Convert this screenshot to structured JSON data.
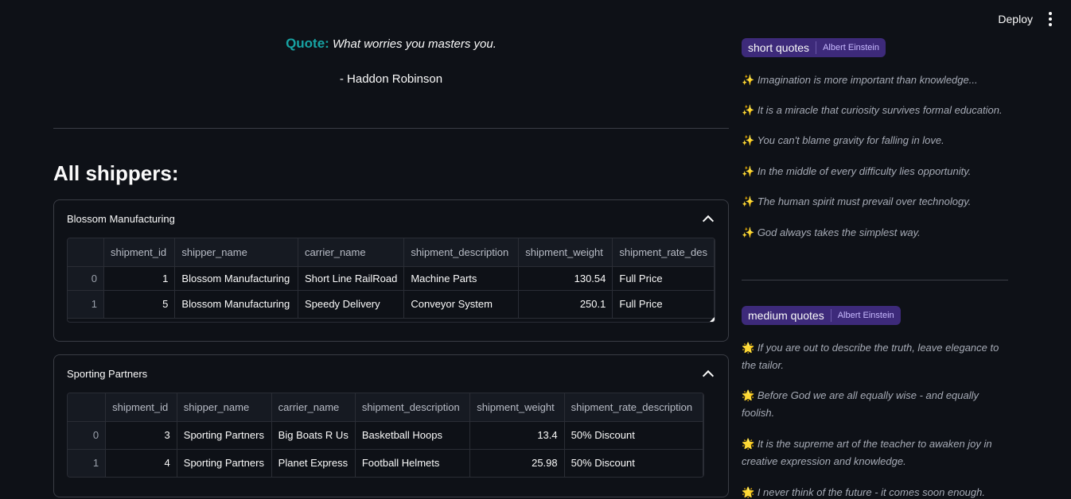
{
  "topbar": {
    "deploy_label": "Deploy"
  },
  "quote": {
    "label": "Quote:",
    "text": "What worries you masters you.",
    "author": "- Haddon Robinson"
  },
  "section_title": "All shippers:",
  "expanders": [
    {
      "title": "Blossom Manufacturing",
      "columns": [
        "",
        "shipment_id",
        "shipper_name",
        "carrier_name",
        "shipment_description",
        "shipment_weight",
        "shipment_rate_des"
      ],
      "rows": [
        [
          "0",
          "1",
          "Blossom Manufacturing",
          "Short Line RailRoad",
          "Machine Parts",
          "130.54",
          "Full Price"
        ],
        [
          "1",
          "5",
          "Blossom Manufacturing",
          "Speedy Delivery",
          "Conveyor System",
          "250.1",
          "Full Price"
        ]
      ]
    },
    {
      "title": "Sporting Partners",
      "columns": [
        "",
        "shipment_id",
        "shipper_name",
        "carrier_name",
        "shipment_description",
        "shipment_weight",
        "shipment_rate_description"
      ],
      "rows": [
        [
          "0",
          "3",
          "Sporting Partners",
          "Big Boats R Us",
          "Basketball Hoops",
          "13.4",
          "50% Discount"
        ],
        [
          "1",
          "4",
          "Sporting Partners",
          "Planet Express",
          "Football Helmets",
          "25.98",
          "50% Discount"
        ]
      ]
    }
  ],
  "sidebar": {
    "short": {
      "tag": "short quotes",
      "author": "Albert Einstein",
      "icon": "✨",
      "quotes": [
        "Imagination is more important than knowledge...",
        "It is a miracle that curiosity survives formal education.",
        "You can't blame gravity for falling in love.",
        "In the middle of every difficulty lies opportunity.",
        "The human spirit must prevail over technology.",
        "God always takes the simplest way."
      ]
    },
    "medium": {
      "tag": "medium quotes",
      "author": "Albert Einstein",
      "icon": "🌟",
      "quotes": [
        "If you are out to describe the truth, leave elegance to the tailor.",
        "Before God we are all equally wise - and equally foolish.",
        "It is the supreme art of the teacher to awaken joy in creative expression and knowledge.",
        "I never think of the future - it comes soon enough."
      ]
    }
  }
}
